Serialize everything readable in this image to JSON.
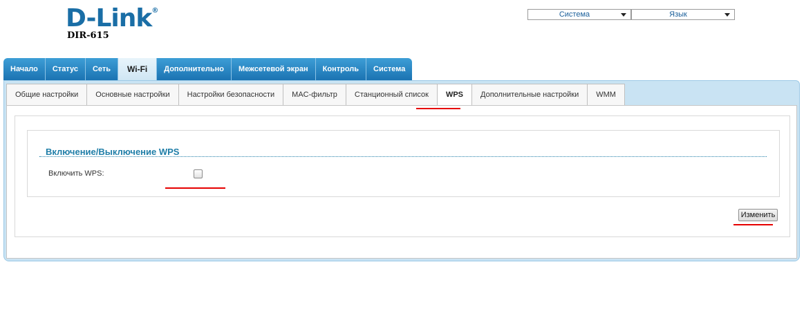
{
  "header": {
    "logo_text": "D-Link",
    "logo_mark": "®",
    "model": "DIR-615",
    "system_select": "Система",
    "language_select": "Язык"
  },
  "main_tabs": [
    {
      "label": "Начало"
    },
    {
      "label": "Статус"
    },
    {
      "label": "Сеть"
    },
    {
      "label": "Wi-Fi",
      "active": true
    },
    {
      "label": "Дополнительно"
    },
    {
      "label": "Межсетевой экран"
    },
    {
      "label": "Контроль"
    },
    {
      "label": "Система"
    }
  ],
  "sub_tabs": [
    {
      "label": "Общие настройки"
    },
    {
      "label": "Основные настройки"
    },
    {
      "label": "Настройки безопасности"
    },
    {
      "label": "MAC-фильтр"
    },
    {
      "label": "Станционный список"
    },
    {
      "label": "WPS",
      "active": true
    },
    {
      "label": "Дополнительные настройки"
    },
    {
      "label": "WMM"
    }
  ],
  "wps_section": {
    "title": "Включение/Выключение WPS",
    "enable_label": "Включить WPS:",
    "enable_checked": false
  },
  "actions": {
    "change_label": "Изменить"
  },
  "colors": {
    "tab_blue": "#1b73b2",
    "panel_blue": "#c9e3f3",
    "title_blue": "#1f7ea8",
    "annotation_red": "#e60000"
  }
}
